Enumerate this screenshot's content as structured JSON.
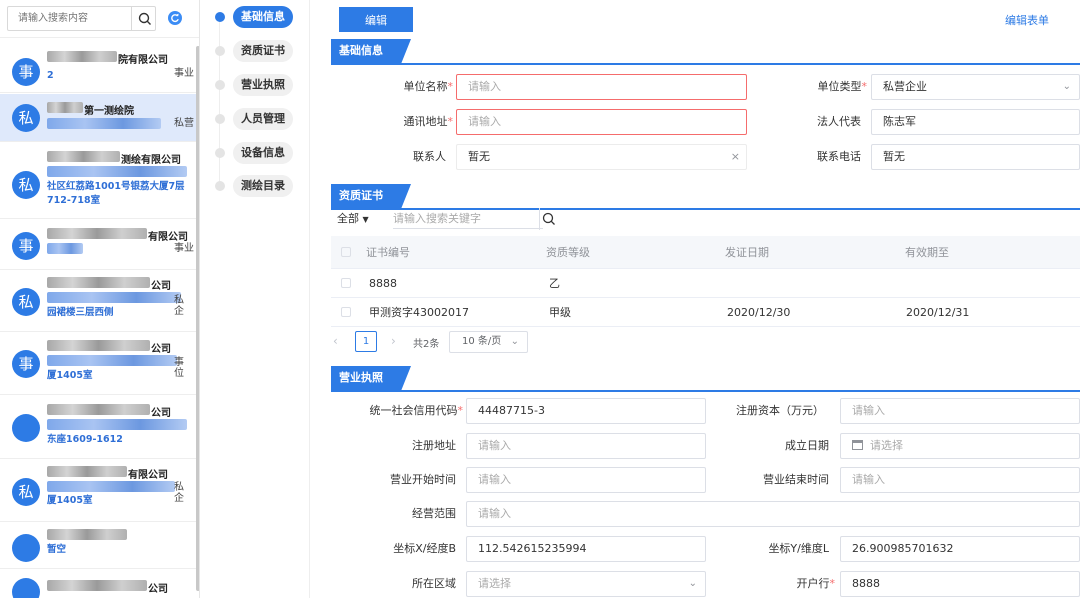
{
  "search": {
    "placeholder": "请输入搜索内容"
  },
  "list": [
    {
      "avatar": "事",
      "name": "院有限公司",
      "addr": "2",
      "type": "事业",
      "selected": false
    },
    {
      "avatar": "私",
      "name": "第一测绘院",
      "addr": "",
      "type": "私营",
      "selected": true
    },
    {
      "avatar": "私",
      "name": "测绘有限公司",
      "addr": "社区红荔路1001号银荔大厦7层712-718室",
      "type": "",
      "selected": false
    },
    {
      "avatar": "事",
      "name": "有限公司",
      "addr": "",
      "type": "事业",
      "selected": false
    },
    {
      "avatar": "私",
      "name": "公司",
      "addr": "园裙楼三层西侧",
      "type": "私企",
      "selected": false
    },
    {
      "avatar": "事",
      "name": "公司",
      "addr": "厦1405室",
      "type": "事位",
      "selected": false
    },
    {
      "avatar": "",
      "name": "公司",
      "addr": "东座1609-1612",
      "type": "",
      "selected": false
    },
    {
      "avatar": "私",
      "name": "有限公司",
      "addr": "厦1405室",
      "type": "私企",
      "selected": false
    },
    {
      "avatar": "",
      "name": "",
      "addr": "暂空",
      "type": "",
      "selected": false
    },
    {
      "avatar": "",
      "name": "公司",
      "addr": "",
      "type": "",
      "selected": false
    }
  ],
  "steps": [
    {
      "label": "基础信息",
      "active": true
    },
    {
      "label": "资质证书",
      "active": false
    },
    {
      "label": "营业执照",
      "active": false
    },
    {
      "label": "人员管理",
      "active": false
    },
    {
      "label": "设备信息",
      "active": false
    },
    {
      "label": "测绘目录",
      "active": false
    }
  ],
  "toolbar": {
    "edit_label": "编辑",
    "edit_form_label": "编辑表单"
  },
  "basic": {
    "title": "基础信息",
    "unit_name_label": "单位名称",
    "unit_name_placeholder": "请输入",
    "unit_type_label": "单位类型",
    "unit_type_value": "私营企业",
    "address_label": "通讯地址",
    "address_placeholder": "请输入",
    "legal_rep_label": "法人代表",
    "legal_rep_value": "陈志军",
    "contact_label": "联系人",
    "contact_value": "暂无",
    "phone_label": "联系电话",
    "phone_value": "暂无"
  },
  "cert": {
    "title": "资质证书",
    "filter": "全部",
    "search_placeholder": "请输入搜索关键字",
    "columns": [
      "证书编号",
      "资质等级",
      "发证日期",
      "有效期至"
    ],
    "rows": [
      [
        "8888",
        "乙",
        "",
        ""
      ],
      [
        "甲测资字43002017",
        "甲级",
        "2020/12/30",
        "2020/12/31"
      ]
    ],
    "page": "1",
    "total": "共2条",
    "page_size": "10 条/页"
  },
  "license": {
    "title": "营业执照",
    "credit_code_label": "统一社会信用代码",
    "credit_code_value": "44487715-3",
    "capital_label": "注册资本（万元）",
    "capital_placeholder": "请输入",
    "reg_addr_label": "注册地址",
    "reg_addr_placeholder": "请输入",
    "found_date_label": "成立日期",
    "found_date_placeholder": "请选择",
    "start_label": "营业开始时间",
    "start_placeholder": "请输入",
    "end_label": "营业结束时间",
    "end_placeholder": "请输入",
    "scope_label": "经营范围",
    "scope_placeholder": "请输入",
    "x_label": "坐标X/经度B",
    "x_value": "112.542615235994",
    "y_label": "坐标Y/维度L",
    "y_value": "26.900985701632",
    "area_label": "所在区域",
    "area_placeholder": "请选择",
    "bank_label": "开户行",
    "bank_value": "8888"
  },
  "colors": {
    "primary": "#2d7be5",
    "error": "#f56c6c",
    "selected_bg": "#dfe9fb"
  }
}
